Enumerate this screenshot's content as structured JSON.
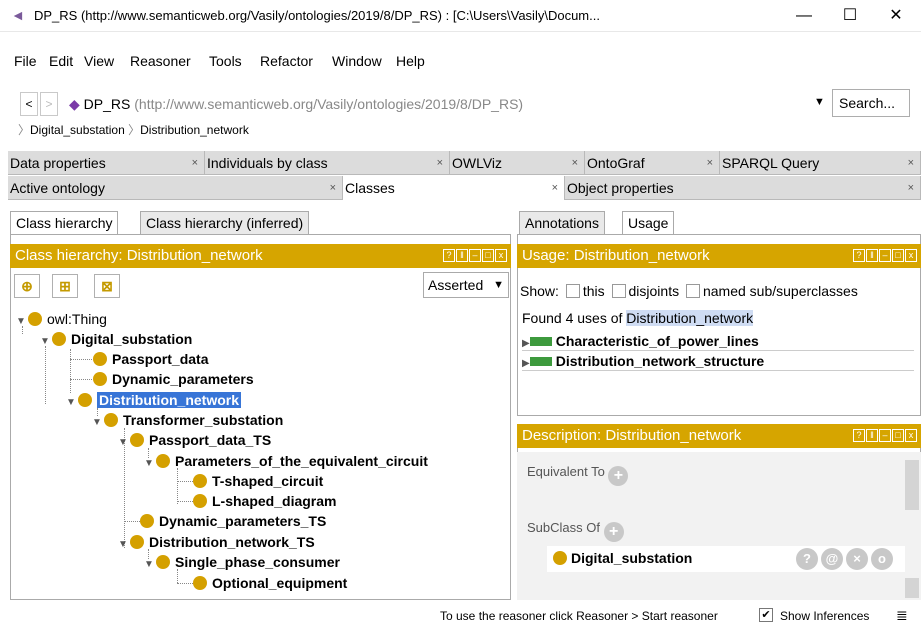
{
  "window": {
    "title": "DP_RS (http://www.semanticweb.org/Vasily/ontologies/2019/8/DP_RS) : [C:\\Users\\Vasily\\Docum...",
    "minimize": "—",
    "maximize": "☐",
    "close": "✕"
  },
  "menu": [
    "File",
    "Edit",
    "View",
    "Reasoner",
    "Tools",
    "Refactor",
    "Window",
    "Help"
  ],
  "address": {
    "back": "<",
    "forward": ">",
    "name": "DP_RS",
    "iri": "(http://www.semanticweb.org/Vasily/ontologies/2019/8/DP_RS)",
    "search_label": "Search..."
  },
  "breadcrumb": [
    "Digital_substation",
    "Distribution_network"
  ],
  "tabs_row1": [
    "Data properties",
    "Individuals by class",
    "OWLViz",
    "OntoGraf",
    "SPARQL Query"
  ],
  "tabs_row2": [
    "Active ontology",
    "Classes",
    "Object properties"
  ],
  "tab_close": "×",
  "left_panel": {
    "subtabs": [
      "Class hierarchy",
      "Class hierarchy (inferred)"
    ],
    "header": "Class hierarchy: Distribution_network",
    "mode": "Asserted",
    "tree": [
      {
        "label": "owl:Thing",
        "depth": 0,
        "expanded": true
      },
      {
        "label": "Digital_substation",
        "depth": 1,
        "expanded": true
      },
      {
        "label": "Passport_data",
        "depth": 2,
        "expanded": false
      },
      {
        "label": "Dynamic_parameters",
        "depth": 2,
        "expanded": false
      },
      {
        "label": "Distribution_network",
        "depth": 2,
        "expanded": true,
        "selected": true
      },
      {
        "label": "Transformer_substation",
        "depth": 3,
        "expanded": true
      },
      {
        "label": "Passport_data_TS",
        "depth": 4,
        "expanded": true
      },
      {
        "label": "Parameters_of_the_equivalent_circuit",
        "depth": 5,
        "expanded": true
      },
      {
        "label": "T-shaped_circuit",
        "depth": 6,
        "expanded": false
      },
      {
        "label": "L-shaped_diagram",
        "depth": 6,
        "expanded": false
      },
      {
        "label": "Dynamic_parameters_TS",
        "depth": 4,
        "expanded": false
      },
      {
        "label": "Distribution_network_TS",
        "depth": 4,
        "expanded": true
      },
      {
        "label": "Single_phase_consumer",
        "depth": 5,
        "expanded": true
      },
      {
        "label": "Optional_equipment",
        "depth": 6,
        "expanded": false
      }
    ]
  },
  "right_panel": {
    "subtabs": [
      "Annotations",
      "Usage"
    ],
    "usage_header": "Usage: Distribution_network",
    "show_label": "Show:",
    "show_options": [
      "this",
      "disjoints",
      "named sub/superclasses"
    ],
    "found_prefix": "Found 4 uses of ",
    "found_term": "Distribution_network",
    "usages": [
      "Characteristic_of_power_lines",
      "Distribution_network_structure"
    ],
    "description_header": "Description: Distribution_network",
    "equivalent_to": "Equivalent To",
    "subclass_of": "SubClass Of",
    "subclass_value": "Digital_substation",
    "row_icons": [
      "?",
      "@",
      "×",
      "o"
    ]
  },
  "status": {
    "message": "To use the reasoner click Reasoner > Start reasoner",
    "show_inferences": "Show Inferences",
    "show_inferences_checked": true
  },
  "colors": {
    "header": "#d6a500",
    "selection": "#3875d7",
    "class_dot": "#d4a000",
    "usage_bar": "#3d9a3d"
  }
}
